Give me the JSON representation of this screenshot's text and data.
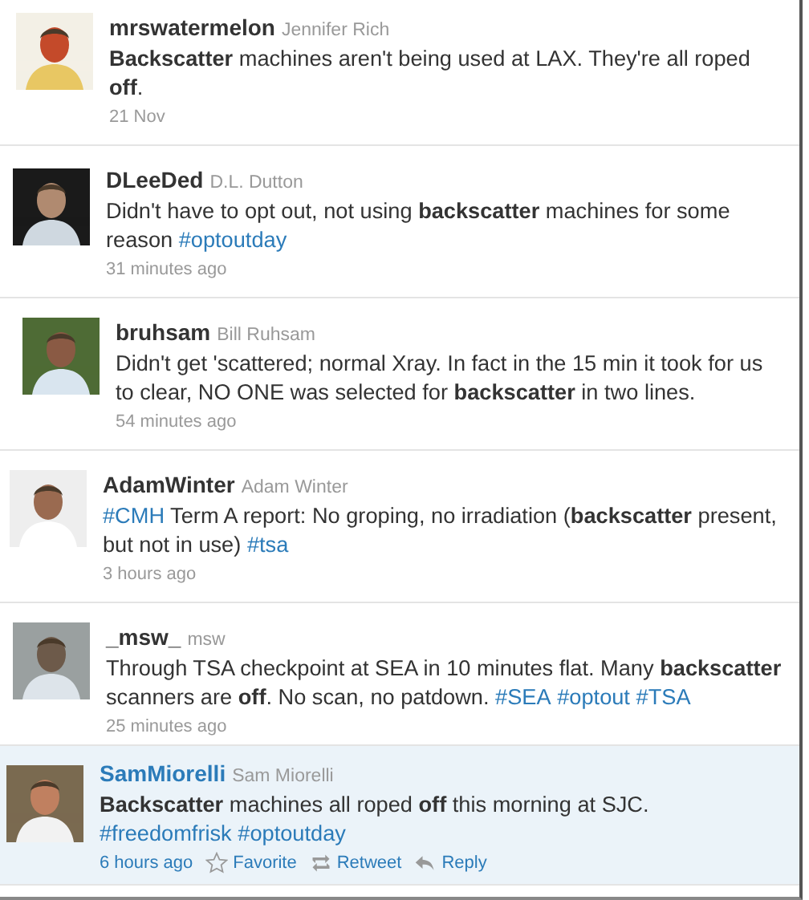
{
  "tweets": [
    {
      "username": "mrswatermelon",
      "full_name": "Jennifer Rich",
      "selected": false,
      "body": [
        {
          "kind": "text",
          "text": "**Backscatter** machines aren't being used at LAX. They're all roped **off**."
        }
      ],
      "time": "21 Nov"
    },
    {
      "username": "DLeeDed",
      "full_name": "D.L. Dutton",
      "selected": false,
      "body": [
        {
          "kind": "text",
          "text": "Didn't have to opt out, not using **backscatter** machines for some reason "
        },
        {
          "kind": "hashtag",
          "text": "#optoutday"
        }
      ],
      "time": "31 minutes ago"
    },
    {
      "username": "bruhsam",
      "full_name": "Bill Ruhsam",
      "selected": false,
      "body": [
        {
          "kind": "text",
          "text": "Didn't get 'scattered; normal Xray. In fact in the 15 min it took for us to clear, NO ONE was selected for **backscatter** in two lines."
        }
      ],
      "time": "54 minutes ago"
    },
    {
      "username": "AdamWinter",
      "full_name": "Adam Winter",
      "selected": false,
      "body": [
        {
          "kind": "hashtag",
          "text": "#CMH"
        },
        {
          "kind": "text",
          "text": " Term A report: No groping, no irradiation (**backscatter** present, but not in use) "
        },
        {
          "kind": "hashtag",
          "text": "#tsa"
        }
      ],
      "time": "3 hours ago"
    },
    {
      "username": "_msw_",
      "full_name": "msw",
      "selected": false,
      "body": [
        {
          "kind": "text",
          "text": "Through TSA checkpoint at SEA in 10 minutes flat. Many **backscatter** scanners are **off**. No scan, no patdown. "
        },
        {
          "kind": "hashtag",
          "text": "#SEA"
        },
        {
          "kind": "hashtag",
          "text": "#optout"
        },
        {
          "kind": "hashtag",
          "text": "#TSA"
        }
      ],
      "time": "25 minutes ago"
    },
    {
      "username": "SamMiorelli",
      "full_name": "Sam Miorelli",
      "selected": true,
      "body": [
        {
          "kind": "text",
          "text": "**Backscatter** machines all roped **off** this morning at SJC. "
        },
        {
          "kind": "hashtag",
          "text": "#freedomfrisk"
        },
        {
          "kind": "hashtag",
          "text": "#optoutday"
        }
      ],
      "time": "6 hours ago",
      "actions": [
        {
          "kind": "favorite",
          "label": "Favorite"
        },
        {
          "kind": "retweet",
          "label": "Retweet"
        },
        {
          "kind": "reply",
          "label": "Reply"
        }
      ]
    }
  ]
}
